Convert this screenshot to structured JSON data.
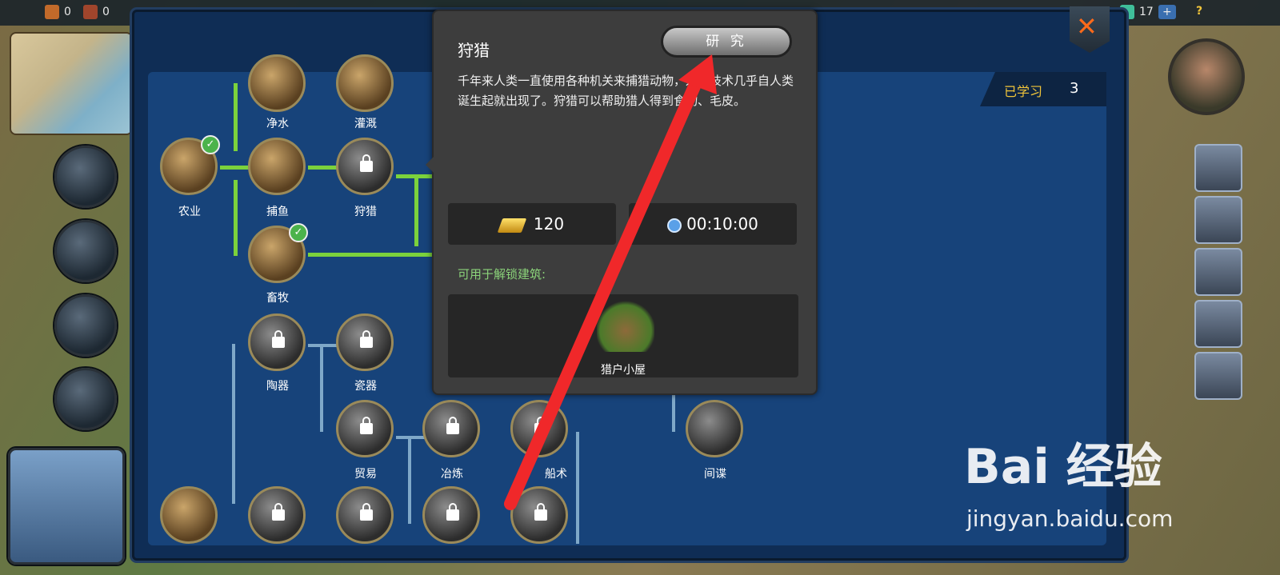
{
  "topbar": {
    "res1_value": "0",
    "res2_value": "0",
    "gem_value": "17",
    "plus_label": "+",
    "help_label": "?"
  },
  "panel": {
    "learned_label": "已学习",
    "learned_value": "3",
    "close_label": "✕"
  },
  "tree": {
    "nodes": {
      "water": "净水",
      "irrigation": "灌溉",
      "agriculture": "农业",
      "fishing": "捕鱼",
      "hunting": "狩猎",
      "husbandry": "畜牧",
      "pottery": "陶器",
      "porcelain": "瓷器",
      "trade": "贸易",
      "smelting": "冶炼",
      "shipbuilding": "船术",
      "espionage": "间谍"
    }
  },
  "popup": {
    "title": "狩猎",
    "research_label": "研 究",
    "description": "千年来人类一直使用各种机关来捕猎动物，这类技术几乎自人类诞生起就出现了。狩猎可以帮助猎人得到食物、毛皮。",
    "cost_gold": "120",
    "time": "00:10:00",
    "unlock_label": "可用于解锁建筑:",
    "building_name": "猎户小屋"
  },
  "watermark": {
    "brand": "Bai 经验",
    "url": "jingyan.baidu.com"
  },
  "colors": {
    "panel_bg": "#0f2d55",
    "tree_bg": "#17437a",
    "learned_path": "#7bd23c",
    "locked_path": "#7fa8c8",
    "popup_bg": "#3d3d3d",
    "accent_orange": "#ff6a1a",
    "arrow_red": "#f0282a"
  }
}
